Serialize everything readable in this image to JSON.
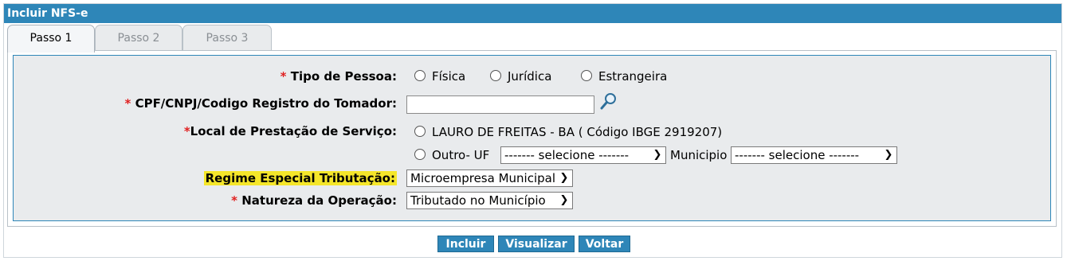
{
  "window": {
    "title": "Incluir NFS-e"
  },
  "tabs": [
    {
      "label": "Passo 1",
      "active": true
    },
    {
      "label": "Passo 2",
      "active": false
    },
    {
      "label": "Passo 3",
      "active": false
    }
  ],
  "form": {
    "required_mark": "*",
    "tipo_pessoa": {
      "label": "Tipo de Pessoa:",
      "options": [
        "Física",
        "Jurídica",
        "Estrangeira"
      ]
    },
    "cpf_cnpj": {
      "label": "CPF/CNPJ/Codigo Registro do Tomador:",
      "value": "",
      "search_icon": "magnifier-icon"
    },
    "local_prestacao": {
      "label": "Local de Prestação de Serviço:",
      "option_local": "LAURO DE FREITAS - BA ( Código IBGE 2919207)",
      "option_outro": "Outro- UF",
      "uf_select": "------- selecione -------",
      "municipio_label": "Municipio",
      "municipio_select": "------- selecione -------"
    },
    "regime": {
      "label": "Regime Especial Tributação:",
      "value": "Microempresa Municipal"
    },
    "natureza": {
      "label": "Natureza da Operação:",
      "value": "Tributado no Município"
    }
  },
  "buttons": {
    "incluir": "Incluir",
    "visualizar": "Visualizar",
    "voltar": "Voltar"
  },
  "colors": {
    "accent": "#2e86b8",
    "highlight": "#f5e62a",
    "required": "#e02020"
  }
}
